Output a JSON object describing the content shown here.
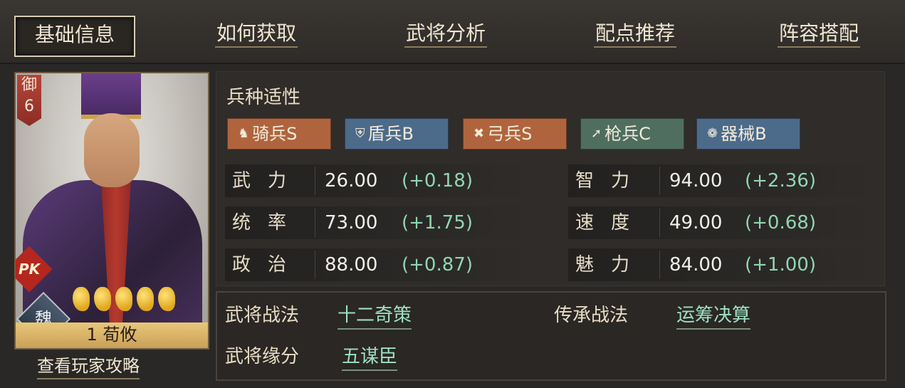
{
  "tabs": [
    {
      "label": "基础信息",
      "active": true
    },
    {
      "label": "如何获取"
    },
    {
      "label": "武将分析"
    },
    {
      "label": "配点推荐"
    },
    {
      "label": "阵容搭配"
    }
  ],
  "card": {
    "badge_top": "御",
    "badge_num": "6",
    "pk": "PK",
    "faction": "魏",
    "stars": 5,
    "name": "1 荀攸",
    "strategy_link": "查看玩家攻略"
  },
  "troops": {
    "title": "兵种适性",
    "items": [
      {
        "label": "骑兵S",
        "icon": "horse-icon",
        "color": "#b0643e"
      },
      {
        "label": "盾兵B",
        "icon": "shield-icon",
        "color": "#4c6a8a"
      },
      {
        "label": "弓兵S",
        "icon": "bow-icon",
        "color": "#b0643e"
      },
      {
        "label": "枪兵C",
        "icon": "spear-icon",
        "color": "#4f6e60"
      },
      {
        "label": "器械B",
        "icon": "gear-icon",
        "color": "#4c6a8a"
      }
    ]
  },
  "stats": {
    "left": [
      {
        "label": "武力",
        "value": "26.00",
        "growth": "(+0.18)"
      },
      {
        "label": "统率",
        "value": "73.00",
        "growth": "(+1.75)"
      },
      {
        "label": "政治",
        "value": "88.00",
        "growth": "(+0.87)"
      }
    ],
    "right": [
      {
        "label": "智力",
        "value": "94.00",
        "growth": "(+2.36)"
      },
      {
        "label": "速度",
        "value": "49.00",
        "growth": "(+0.68)"
      },
      {
        "label": "魅力",
        "value": "84.00",
        "growth": "(+1.00)"
      }
    ]
  },
  "skills": {
    "tactic_label": "武将战法",
    "tactic_value": "十二奇策",
    "inherit_label": "传承战法",
    "inherit_value": "运筹决算",
    "bond_label": "武将缘分",
    "bond_value": "五谋臣"
  }
}
